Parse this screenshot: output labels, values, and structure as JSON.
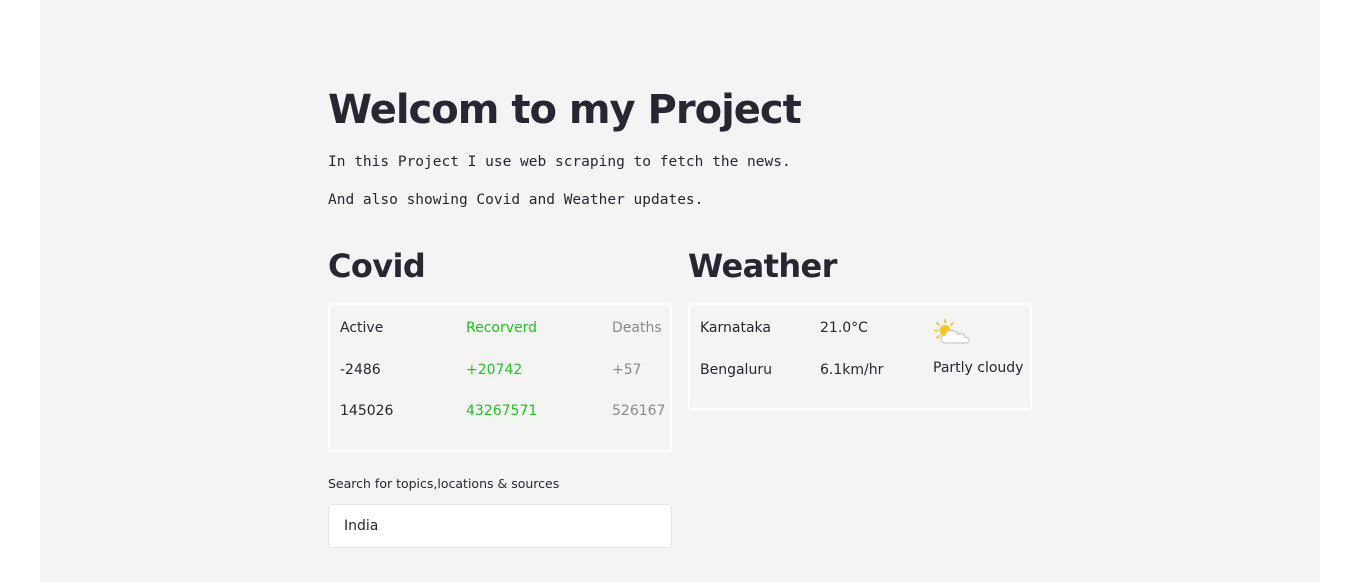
{
  "header": {
    "title": "Welcom to my Project",
    "intro_line1": "In this Project I use web scraping to fetch the news.",
    "intro_line2": "And also showing Covid and Weather updates."
  },
  "covid": {
    "title": "Covid",
    "columns": [
      "Active",
      "Recorverd",
      "Deaths"
    ],
    "rows": [
      [
        "-2486",
        "+20742",
        "+57"
      ],
      [
        "145026",
        "43267571",
        "526167"
      ]
    ],
    "colors": {
      "active": "#262730",
      "recovered": "#21c321",
      "deaths": "#8a8a8a"
    }
  },
  "weather": {
    "title": "Weather",
    "state": "Karnataka",
    "city": "Bengaluru",
    "temperature": "21.0°C",
    "wind": "6.1km/hr",
    "condition": "Partly cloudy",
    "condition_icon": "partly-cloudy-icon"
  },
  "search": {
    "label": "Search for topics,locations & sources",
    "value": "India"
  }
}
